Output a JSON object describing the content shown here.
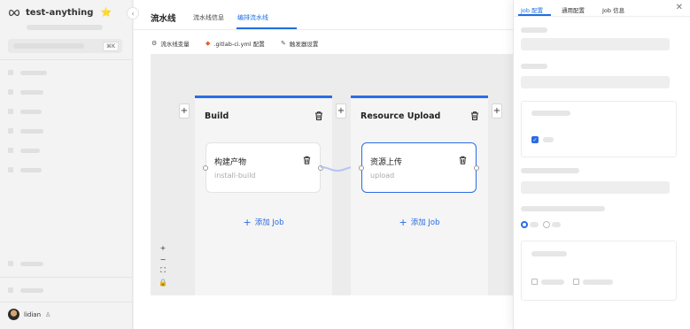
{
  "sidebar": {
    "project_name": "test-anything",
    "project_star": "⭐",
    "collapse_icon": "‹",
    "search_shortcut": "⌘K",
    "user_name": "lidian",
    "user_icon": "♙"
  },
  "header": {
    "page_title": "流水线",
    "tabs": [
      {
        "label": "流水线信息"
      },
      {
        "label": "编排流水线"
      }
    ]
  },
  "toolbar": {
    "variables_icon": "⚙",
    "variables_label": "流水线变量",
    "gitlab_icon": "◆",
    "gitlab_label": ".gitlab-ci.yml 配置",
    "trigger_icon": "✎",
    "trigger_label": "触发器设置"
  },
  "stages": [
    {
      "title": "Build",
      "job": {
        "name": "构建产物",
        "sub": "install-build"
      },
      "add_label": "添加 Job"
    },
    {
      "title": "Resource Upload",
      "job": {
        "name": "资源上传",
        "sub": "upload"
      },
      "add_label": "添加 Job"
    }
  ],
  "plus_label": "+",
  "zoom": {
    "zoom_in": "+",
    "zoom_out": "−",
    "fit": "⛶",
    "lock": "🔒"
  },
  "panel": {
    "tabs": [
      {
        "label": "Job 配置"
      },
      {
        "label": "通用配置"
      },
      {
        "label": "Job 信息"
      }
    ],
    "close": "✕",
    "check_mark": "✓"
  },
  "colors": {
    "accent": "#2a6ce4",
    "star": "#f2b705",
    "gitlab": "#e2622a"
  }
}
